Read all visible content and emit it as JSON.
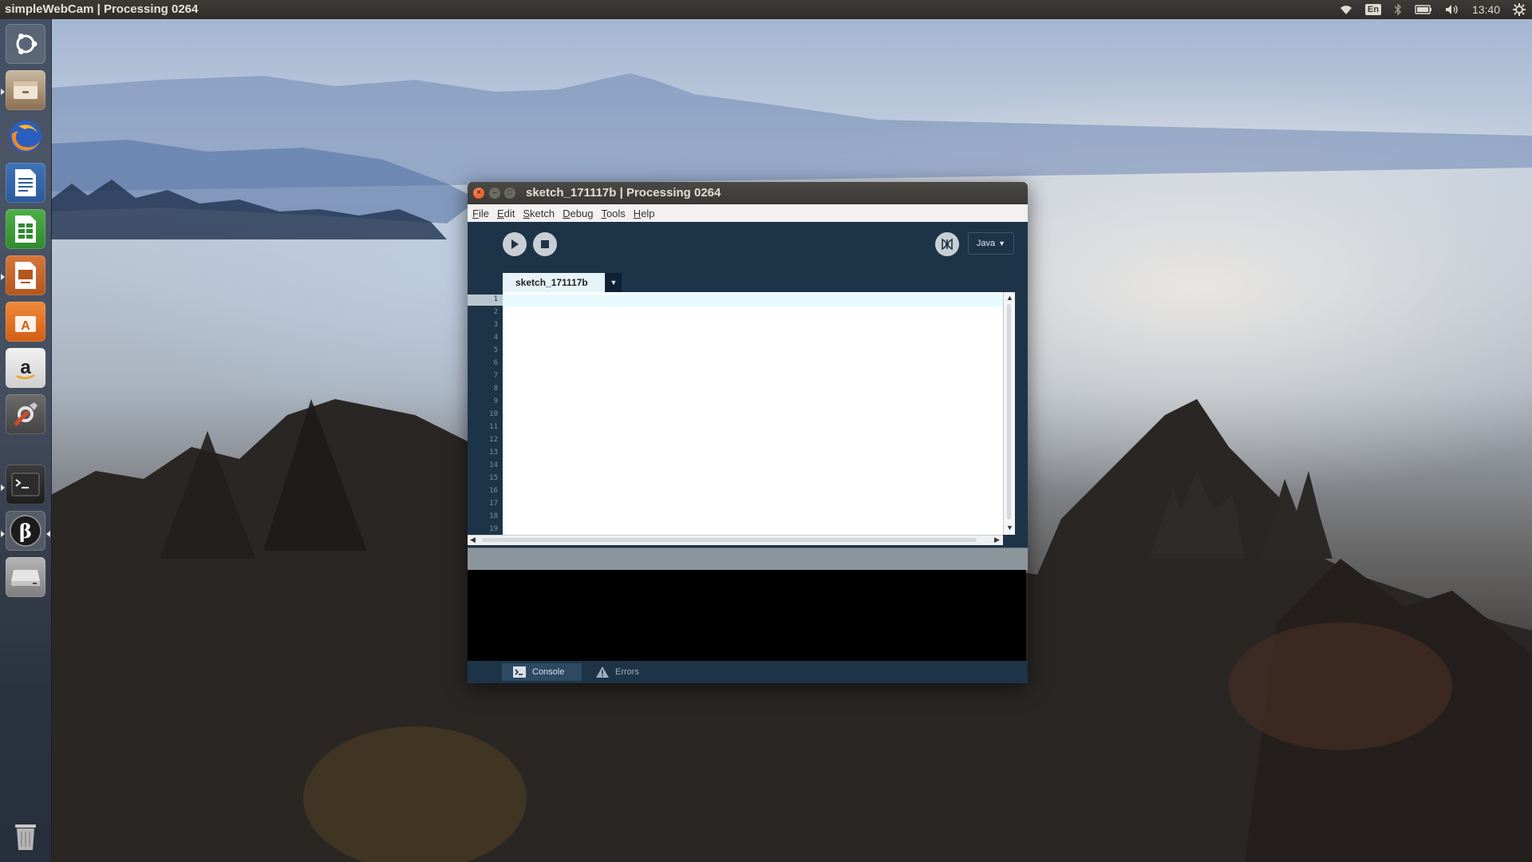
{
  "top_panel": {
    "title": "simpleWebCam | Processing 0264",
    "keyboard_layout": "En",
    "clock": "13:40",
    "icons": [
      "wifi-icon",
      "keyboard-layout-indicator",
      "bluetooth-icon",
      "battery-icon",
      "volume-icon",
      "settings-gear-icon"
    ]
  },
  "launcher": {
    "items": [
      "ubuntu-dash",
      "files",
      "firefox",
      "libreoffice-writer",
      "libreoffice-calc",
      "libreoffice-impress",
      "ubuntu-software",
      "amazon",
      "system-settings",
      "terminal",
      "processing",
      "drive",
      "trash"
    ]
  },
  "window": {
    "title": "sketch_171117b | Processing 0264",
    "menu": [
      "File",
      "Edit",
      "Sketch",
      "Debug",
      "Tools",
      "Help"
    ],
    "mode": "Java",
    "tab_name": "sketch_171117b",
    "line_numbers": [
      "1",
      "2",
      "3",
      "4",
      "5",
      "6",
      "7",
      "8",
      "9",
      "10",
      "11",
      "12",
      "13",
      "14",
      "15",
      "16",
      "17",
      "18",
      "19"
    ],
    "bottom_tabs": {
      "console": "Console",
      "errors": "Errors"
    }
  }
}
